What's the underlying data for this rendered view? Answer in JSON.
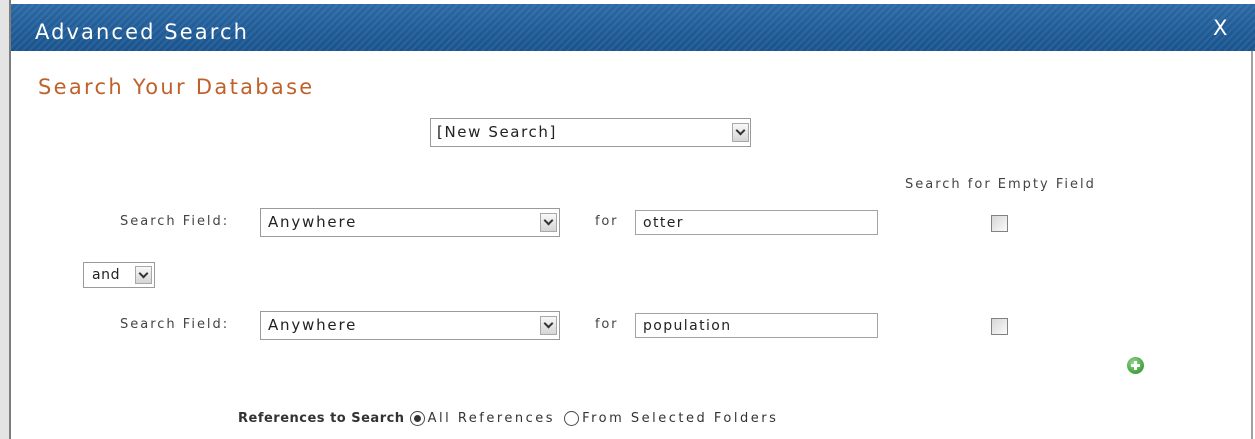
{
  "dialog": {
    "title": "Advanced Search",
    "close_label": "X",
    "heading": "Search Your Database"
  },
  "saved_search": {
    "selected": "[New Search]"
  },
  "empty_field_header": "Search for Empty Field",
  "criteria": [
    {
      "field_label": "Search Field:",
      "field": "Anywhere",
      "for_label": "for",
      "term": "otter",
      "search_empty": false
    },
    {
      "field_label": "Search Field:",
      "field": "Anywhere",
      "for_label": "for",
      "term": "population",
      "search_empty": false
    }
  ],
  "operator": "and",
  "references": {
    "label": "References to Search",
    "options": [
      {
        "label": "All References",
        "selected": true
      },
      {
        "label": "From Selected Folders",
        "selected": false
      }
    ]
  },
  "icons": {
    "dropdown": "chevron-down-icon",
    "add_criterion": "plus-circle-icon",
    "close": "close-icon"
  },
  "colors": {
    "titlebar": "#1f5b96",
    "heading": "#c0612b",
    "add_icon": "#4aa845"
  }
}
